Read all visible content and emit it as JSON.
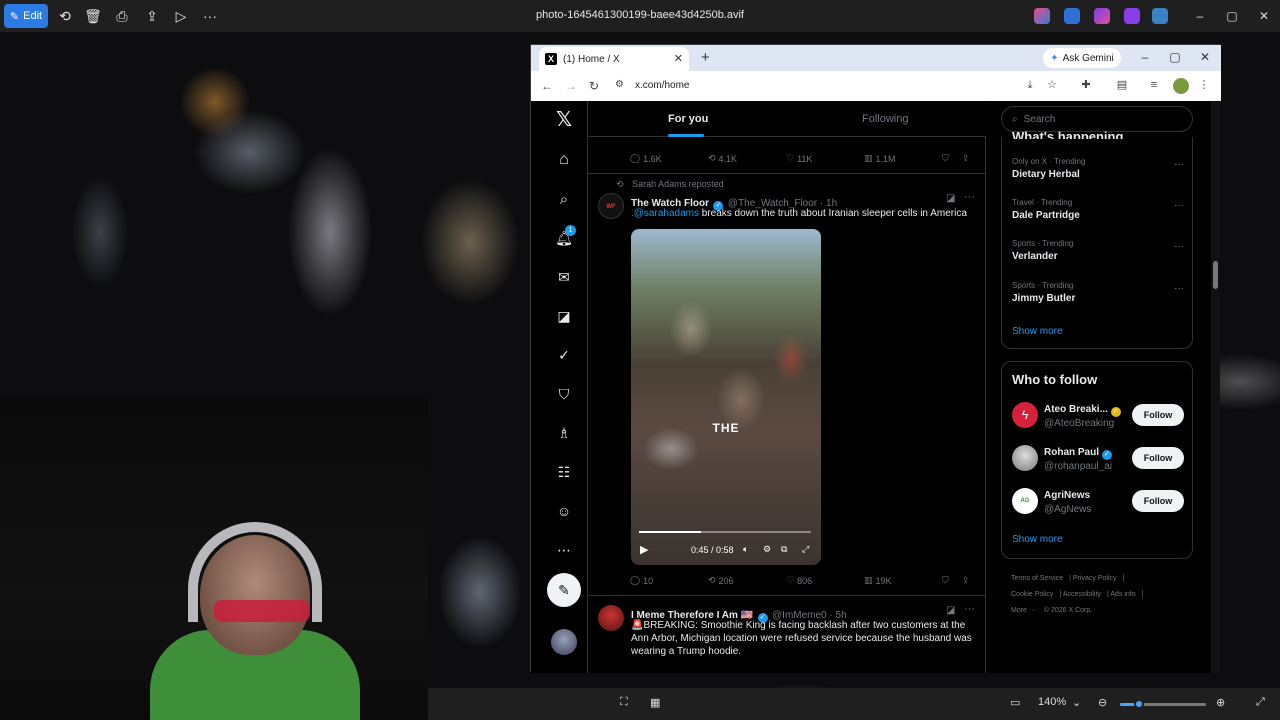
{
  "viewer": {
    "edit_label": "Edit",
    "title": "photo-1645461300199-baee43d4250b.avif",
    "zoom": "140%",
    "zoom_fraction": 0.22
  },
  "browser": {
    "tab_title": "(1) Home / X",
    "gemini_label": "Ask Gemini",
    "url": "x.com/home"
  },
  "nav": {
    "notification_count": "1"
  },
  "timeline": {
    "tabs": [
      "For you",
      "Following"
    ],
    "top_actions": {
      "replies": "1.6K",
      "reposts": "4.1K",
      "likes": "11K",
      "views": "1.1M"
    },
    "tweet1": {
      "reposted_by": "Sarah Adams reposted",
      "name": "The Watch Floor",
      "handle": "@The_Watch_Floor · 1h",
      "mention": ".@sarahadams",
      "text": " breaks down the truth about Iranian sleeper cells in America",
      "video_caption": "THE",
      "video_time": "0:45 / 0:58",
      "video_progress": 0.36,
      "replies": "10",
      "reposts": "206",
      "likes": "806",
      "views": "19K"
    },
    "tweet2": {
      "name": "I Meme Therefore I Am 🇺🇸",
      "handle": "@ImMeme0 · 5h",
      "text": "🚨BREAKING: Smoothie King is facing backlash after two customers at the Ann Arbor, Michigan location were refused service because the husband was wearing a Trump hoodie."
    }
  },
  "sidebar": {
    "search_placeholder": "Search",
    "trends_header": "What's happening",
    "trends": [
      {
        "meta": "Only on X · Trending",
        "name": "Dietary Herbal"
      },
      {
        "meta": "Travel · Trending",
        "name": "Dale Partridge"
      },
      {
        "meta": "Sports · Trending",
        "name": "Verlander"
      },
      {
        "meta": "Sports · Trending",
        "name": "Jimmy Butler"
      }
    ],
    "show_more": "Show more",
    "who_to_follow": "Who to follow",
    "follow_suggestions": [
      {
        "name": "Ateo Breaki...",
        "handle": "@AteoBreaking",
        "button": "Follow"
      },
      {
        "name": "Rohan Paul",
        "handle": "@rohanpaul_ai",
        "button": "Follow"
      },
      {
        "name": "AgriNews",
        "handle": "@AgNews",
        "button": "Follow"
      }
    ],
    "footer": [
      "Terms of Service",
      "Privacy Policy",
      "Cookie Policy",
      "Accessibility",
      "Ads info",
      "More ···",
      "© 2026 X Corp."
    ]
  },
  "colors": {
    "accent": "#1d9bf0",
    "edit_button": "#2c7be5",
    "background": "#000000"
  }
}
